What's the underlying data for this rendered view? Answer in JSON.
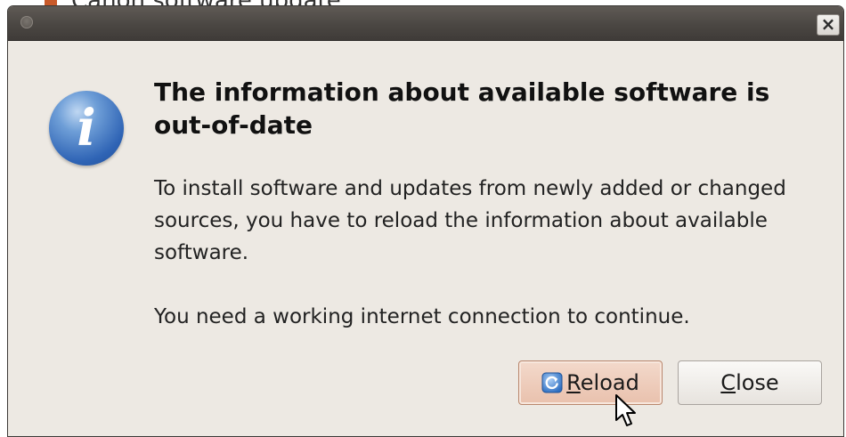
{
  "background_window": {
    "text": "Canon software update"
  },
  "dialog": {
    "heading": "The information about available software is out-of-date",
    "paragraphs": [
      "To install software and updates from newly added or changed sources, you have to reload the information about available software.",
      "You need a working internet connection to continue."
    ],
    "icon": "information-icon",
    "close_glyph": "×"
  },
  "buttons": {
    "reload": {
      "mnemonic": "R",
      "rest": "eload"
    },
    "close": {
      "mnemonic": "C",
      "rest": "lose"
    }
  },
  "colors": {
    "dialog_bg": "#ede9e3",
    "titlebar": "#4b4743",
    "reload_bg": "#e9c1ad",
    "info_blue": "#2f64b5"
  }
}
